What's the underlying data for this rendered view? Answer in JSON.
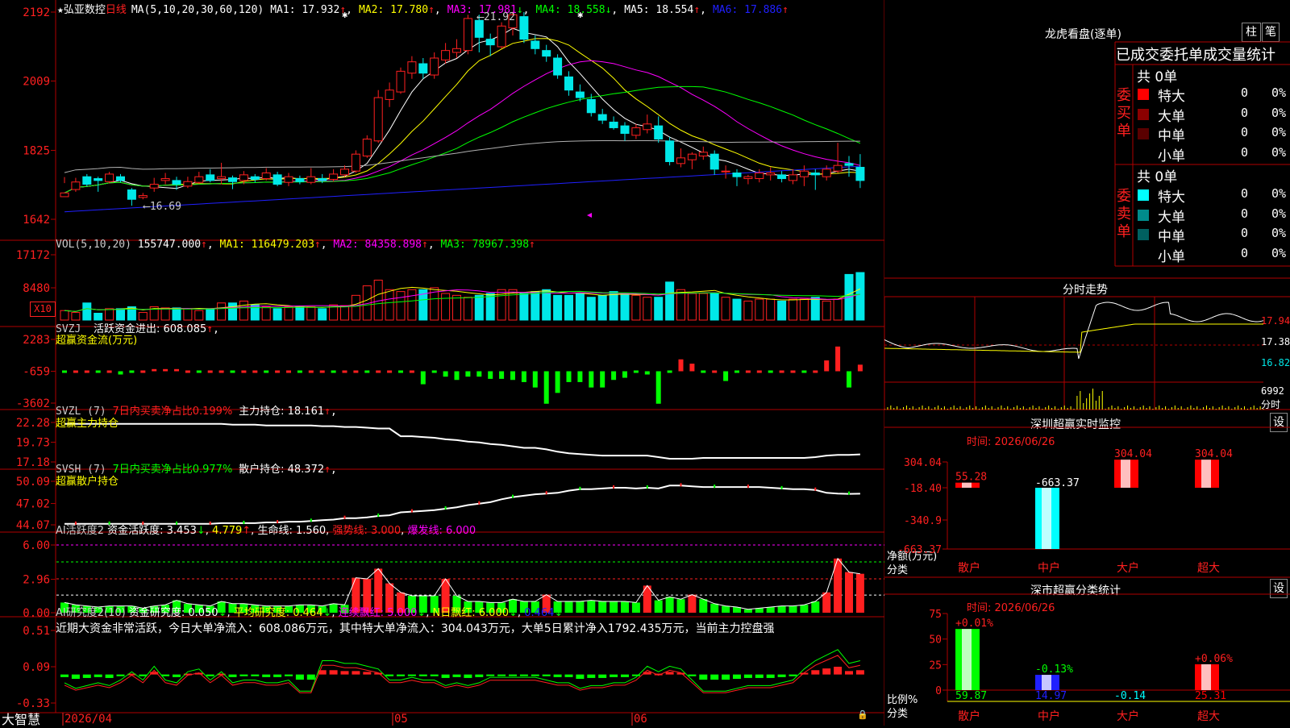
{
  "app": {
    "brand": "大智慧"
  },
  "colors": {
    "up": "#ff2020",
    "down": "#00e8e8",
    "green": "#00ff00",
    "grid": "#b00000",
    "white": "#ffffff",
    "yellow": "#ffff00",
    "magenta": "#ff00ff",
    "blue": "#2020ff"
  },
  "icons": {
    "star": "star-icon",
    "up": "arrow-up-icon",
    "down": "arrow-down-icon",
    "lock": "lock-icon"
  },
  "main": {
    "stock": "弘亚数控",
    "period": "日线",
    "ma_label": "MA(5,10,20,30,60,120)",
    "ma": [
      {
        "label": "MA1: 17.932",
        "dir": "up",
        "color": "#ffffff"
      },
      {
        "label": "MA2: 17.780",
        "dir": "up",
        "color": "#ffff00"
      },
      {
        "label": "MA3: 17.981",
        "dir": "down",
        "color": "#ff00ff"
      },
      {
        "label": "MA4: 18.558",
        "dir": "down",
        "color": "#00ff00"
      },
      {
        "label": "MA5: 18.554",
        "dir": "up",
        "color": "#ffffff"
      },
      {
        "label": "MA6: 17.886",
        "dir": "up",
        "color": "#2020ff"
      }
    ],
    "yticks": [
      "2192",
      "2009",
      "1825",
      "1642"
    ],
    "high_label": "21.92",
    "low_label": "16.69",
    "x_labels": [
      "2026/04",
      "05",
      "06"
    ]
  },
  "vol": {
    "label": "VOL(5,10,20)",
    "value": "155747.000",
    "ma1": "MA1: 116479.203",
    "ma2": "MA2: 84358.898",
    "ma3": "MA3: 78967.398",
    "yticks": [
      "17172",
      "8480"
    ],
    "unit": "X10"
  },
  "svzj": {
    "title": "SVZJ",
    "label": "活跃资金进出: 608.085",
    "sub": "超赢资金流(万元)",
    "yticks": [
      "2283",
      "-659",
      "-3602"
    ]
  },
  "svzl": {
    "title": "SVZL (7)",
    "ratio": "7日内买卖净占比0.199%",
    "hold": "主力持仓: 18.161",
    "sub": "超赢主力持仓",
    "yticks": [
      "22.28",
      "19.73",
      "17.18"
    ]
  },
  "svsh": {
    "title": "SVSH (7)",
    "ratio": "7日内买卖净占比0.977%",
    "hold": "散户持仓: 48.372",
    "sub": "超赢散户持仓",
    "yticks": [
      "50.09",
      "47.02",
      "44.07"
    ]
  },
  "ai1": {
    "title": "AI活跃度2",
    "active": "资金活跃度: 3.453",
    "v2": "4.779",
    "life": "生命线: 1.560",
    "strong": "强势线: 3.000",
    "burst": "爆发线: 6.000",
    "yticks": [
      "6.00",
      "2.96",
      "0.00"
    ]
  },
  "ai2": {
    "title": "AI研究度2(10)",
    "research": "资金研究度: 0.050",
    "avg": "平均研究度: 0.464",
    "cont": "连续飘红: 5.000",
    "nday": "N日飘红: 6.000",
    "v5": "0.464",
    "comment": "近期大资金非常活跃，今日大单净流入：608.086万元，其中特大单净流入：304.043万元，大单5日累计净入1792.435万元，当前主力控盘强",
    "yticks": [
      "0.51",
      "0.09",
      "-0.33"
    ]
  },
  "dragon": {
    "title": "龙虎看盘(逐单)",
    "btn1": "柱",
    "btn2": "笔",
    "header": "已成交委托单成交量统计",
    "buy_label": "委买单",
    "sell_label": "委卖单",
    "buy_total": "共 0单",
    "sell_total": "共 0单",
    "buy_rows": [
      {
        "name": "特大",
        "count": "0",
        "pct": "0%",
        "color": "#ff0000"
      },
      {
        "name": "大单",
        "count": "0",
        "pct": "0%",
        "color": "#8b0000"
      },
      {
        "name": "中单",
        "count": "0",
        "pct": "0%",
        "color": "#5a0000"
      },
      {
        "name": "小单",
        "count": "0",
        "pct": "0%",
        "color": "#000000"
      }
    ],
    "sell_rows": [
      {
        "name": "特大",
        "count": "0",
        "pct": "0%",
        "color": "#00ffff"
      },
      {
        "name": "大单",
        "count": "0",
        "pct": "0%",
        "color": "#008b8b"
      },
      {
        "name": "中单",
        "count": "0",
        "pct": "0%",
        "color": "#006060"
      },
      {
        "name": "小单",
        "count": "0",
        "pct": "0%",
        "color": "#000000"
      }
    ]
  },
  "intraday": {
    "title": "分时走势",
    "prices": [
      "17.94",
      "17.38",
      "16.82"
    ],
    "vol": "6992",
    "vol_unit": "分时"
  },
  "monitor": {
    "title": "深圳超赢实时监控",
    "btn": "设",
    "time": "时间: 2026/06/26",
    "yticks": [
      "304.04",
      "-18.40",
      "-340.9",
      "-663.37"
    ],
    "bars": [
      {
        "label": "散户",
        "value": 55.28,
        "text": "55.28",
        "color": "#ff0000"
      },
      {
        "label": "中户",
        "value": -663.37,
        "text": "-663.37",
        "color": "#00ffff"
      },
      {
        "label": "大户",
        "value": 304.04,
        "text": "304.04",
        "color": "#ff0000"
      },
      {
        "label": "超大",
        "value": 304.04,
        "text": "304.04",
        "color": "#ff0000"
      }
    ],
    "axis_label": "净额(万元)",
    "axis_sub": "分类"
  },
  "stats": {
    "title": "深市超赢分类统计",
    "btn": "设",
    "time": "时间: 2026/06/26",
    "yticks": [
      "75",
      "50",
      "25",
      "0"
    ],
    "bars": [
      {
        "label": "散户",
        "value": 59.87,
        "pct": "+0.01%",
        "bottom": "59.87",
        "color": "#00ff00"
      },
      {
        "label": "中户",
        "value": 14.97,
        "pct": "-0.13%",
        "bottom": "14.97",
        "color": "#2020ff"
      },
      {
        "label": "大户",
        "value": -0.14,
        "pct": "",
        "bottom": "-0.14",
        "color": "#00ffff"
      },
      {
        "label": "超大",
        "value": 25.31,
        "pct": "+0.06%",
        "bottom": "25.31",
        "color": "#ff0000"
      }
    ],
    "axis_label": "比例%",
    "axis_sub": "分类"
  },
  "chart_data": [
    {
      "type": "candlestick",
      "title": "弘亚数控 日线",
      "ylim": [
        16.42,
        21.92
      ],
      "yticks": [
        21.92,
        20.09,
        18.25,
        16.42
      ],
      "candles": [
        [
          17.02,
          17.12,
          17.54,
          17.38
        ],
        [
          17.21,
          17.41,
          17.52,
          17.15
        ],
        [
          17.55,
          17.35,
          17.62,
          17.3
        ],
        [
          17.5,
          17.45,
          17.55,
          17.15
        ],
        [
          17.42,
          17.62,
          17.68,
          17.38
        ],
        [
          17.55,
          17.45,
          17.62,
          17.4
        ],
        [
          17.2,
          16.95,
          17.25,
          16.78
        ],
        [
          17.0,
          17.05,
          17.12,
          16.95
        ],
        [
          17.25,
          17.35,
          17.52,
          17.15
        ],
        [
          17.45,
          17.5,
          17.65,
          17.35
        ],
        [
          17.45,
          17.35,
          17.55,
          17.2
        ],
        [
          17.3,
          17.42,
          17.55,
          17.25
        ],
        [
          17.4,
          17.55,
          17.68,
          17.35
        ],
        [
          17.6,
          17.45,
          17.75,
          17.4
        ],
        [
          17.5,
          17.55,
          17.92,
          17.35
        ],
        [
          17.52,
          17.42,
          17.58,
          17.22
        ],
        [
          17.45,
          17.6,
          17.7,
          17.35
        ],
        [
          17.55,
          17.48,
          17.62,
          17.4
        ],
        [
          17.5,
          17.65,
          17.78,
          17.45
        ],
        [
          17.6,
          17.35,
          17.68,
          17.3
        ],
        [
          17.4,
          17.55,
          17.65,
          17.3
        ],
        [
          17.5,
          17.42,
          17.58,
          17.35
        ],
        [
          17.4,
          17.55,
          17.78,
          17.35
        ],
        [
          17.5,
          17.45,
          17.62,
          17.38
        ],
        [
          17.48,
          17.62,
          17.75,
          17.42
        ],
        [
          17.6,
          17.75,
          17.85,
          17.55
        ],
        [
          17.7,
          18.15,
          18.25,
          17.65
        ],
        [
          18.1,
          18.55,
          18.65,
          18.05
        ],
        [
          18.5,
          19.65,
          19.85,
          18.45
        ],
        [
          19.6,
          19.85,
          20.05,
          19.4
        ],
        [
          19.8,
          20.35,
          20.45,
          19.75
        ],
        [
          20.3,
          20.6,
          20.75,
          20.15
        ],
        [
          20.55,
          20.3,
          20.7,
          20.15
        ],
        [
          20.25,
          20.7,
          20.85,
          20.15
        ],
        [
          20.65,
          20.9,
          21.1,
          20.55
        ],
        [
          20.85,
          20.95,
          21.2,
          20.7
        ],
        [
          20.9,
          21.75,
          21.85,
          20.8
        ],
        [
          21.7,
          21.25,
          21.85,
          20.85
        ],
        [
          21.2,
          21.05,
          21.35,
          20.75
        ],
        [
          21.0,
          21.55,
          21.65,
          20.95
        ],
        [
          21.5,
          21.85,
          21.92,
          21.3
        ],
        [
          21.8,
          21.2,
          21.92,
          21.1
        ],
        [
          21.15,
          20.95,
          21.3,
          20.8
        ],
        [
          20.9,
          20.75,
          21.05,
          20.6
        ],
        [
          20.7,
          20.25,
          20.8,
          20.15
        ],
        [
          20.2,
          19.85,
          20.35,
          19.7
        ],
        [
          19.8,
          19.65,
          20.0,
          19.55
        ],
        [
          19.6,
          19.25,
          19.75,
          19.15
        ],
        [
          19.2,
          19.05,
          19.35,
          18.95
        ],
        [
          19.0,
          18.85,
          19.15,
          18.8
        ],
        [
          18.9,
          18.7,
          19.0,
          18.5
        ],
        [
          18.65,
          18.85,
          18.95,
          18.55
        ],
        [
          18.8,
          18.95,
          19.2,
          18.7
        ],
        [
          18.9,
          18.55,
          19.15,
          18.45
        ],
        [
          18.5,
          17.95,
          18.6,
          17.85
        ],
        [
          17.9,
          18.05,
          18.3,
          17.8
        ],
        [
          18.0,
          18.15,
          18.2,
          17.75
        ],
        [
          18.1,
          18.2,
          18.35,
          18.0
        ],
        [
          18.15,
          17.75,
          18.25,
          17.6
        ],
        [
          17.7,
          17.7,
          17.85,
          17.5
        ],
        [
          17.65,
          17.55,
          17.75,
          17.3
        ],
        [
          17.5,
          17.55,
          17.6,
          17.35
        ],
        [
          17.5,
          17.65,
          17.75,
          17.4
        ],
        [
          17.6,
          17.65,
          17.8,
          17.45
        ],
        [
          17.6,
          17.5,
          17.7,
          17.4
        ],
        [
          17.45,
          17.6,
          17.75,
          17.35
        ],
        [
          17.55,
          17.7,
          17.85,
          17.3
        ],
        [
          17.65,
          17.6,
          17.75,
          17.2
        ],
        [
          17.55,
          17.75,
          17.85,
          17.45
        ],
        [
          17.7,
          17.85,
          18.45,
          17.65
        ],
        [
          17.9,
          17.85,
          18.1,
          17.55
        ],
        [
          17.8,
          17.45,
          18.15,
          17.25
        ]
      ],
      "series": [
        {
          "name": "MA1"
        },
        {
          "name": "MA2"
        },
        {
          "name": "MA3"
        },
        {
          "name": "MA4"
        },
        {
          "name": "MA5"
        },
        {
          "name": "MA6"
        }
      ]
    },
    {
      "type": "bar",
      "title": "VOL(5,10,20)",
      "ylim": [
        0,
        17172
      ],
      "values": [
        2500,
        2000,
        4500,
        1800,
        3000,
        3000,
        3500,
        2000,
        3500,
        3200,
        3200,
        3000,
        2500,
        3000,
        4500,
        4500,
        5000,
        4000,
        3500,
        3000,
        3500,
        3500,
        3500,
        3000,
        4000,
        3800,
        6500,
        9000,
        10500,
        8000,
        7500,
        8000,
        8000,
        8500,
        7000,
        6500,
        6000,
        6500,
        7000,
        8000,
        8000,
        7000,
        7500,
        8000,
        6500,
        6500,
        7000,
        6000,
        6500,
        7500,
        7000,
        6500,
        6000,
        6000,
        10000,
        8000,
        7000,
        7000,
        7000,
        6000,
        5500,
        5000,
        5500,
        5500,
        5000,
        5500,
        5500,
        6000,
        5000,
        5500,
        12000,
        12500
      ]
    },
    {
      "type": "bar",
      "title": "SVZJ",
      "ylim": [
        -3602,
        2283
      ],
      "values": [
        0,
        0,
        0,
        0,
        0,
        -300,
        0,
        0,
        200,
        200,
        200,
        0,
        0,
        0,
        0,
        0,
        0,
        0,
        0,
        0,
        0,
        0,
        0,
        0,
        0,
        0,
        0,
        0,
        0,
        0,
        0,
        0,
        -1200,
        0,
        -500,
        -800,
        -500,
        -500,
        -700,
        -700,
        -800,
        -1000,
        -1500,
        -3000,
        -2000,
        -1000,
        -1000,
        -1500,
        -1500,
        -800,
        -600,
        0,
        -300,
        -3000,
        0,
        1100,
        700,
        0,
        0,
        -900,
        0,
        0,
        0,
        0,
        0,
        0,
        0,
        0,
        1000,
        2283,
        -1500,
        608
      ]
    },
    {
      "type": "line",
      "title": "SVZL (7)",
      "ylim": [
        17.18,
        22.28
      ],
      "values": [
        22.1,
        22.1,
        22.1,
        22.1,
        22.1,
        22.1,
        22.1,
        22.1,
        22.1,
        22.1,
        22.1,
        22.1,
        22.1,
        22.1,
        22.1,
        22.0,
        22.0,
        22.0,
        21.9,
        21.9,
        21.9,
        21.9,
        21.9,
        21.8,
        21.8,
        21.7,
        21.7,
        21.6,
        21.5,
        21.5,
        20.5,
        20.5,
        20.4,
        20.3,
        20.1,
        20.0,
        19.8,
        19.7,
        19.5,
        19.4,
        19.2,
        19.0,
        19.0,
        18.8,
        18.5,
        18.3,
        18.2,
        18.1,
        18.0,
        18.0,
        18.0,
        18.0,
        18.0,
        17.8,
        17.6,
        17.6,
        17.6,
        17.7,
        17.7,
        17.7,
        17.7,
        17.7,
        17.7,
        17.7,
        17.7,
        17.7,
        17.7,
        17.8,
        18.0,
        18.1,
        18.1,
        18.16
      ]
    },
    {
      "type": "line",
      "title": "SVSH (7)",
      "ylim": [
        44.07,
        50.09
      ],
      "values": [
        44.2,
        44.2,
        44.2,
        44.2,
        44.2,
        44.2,
        44.2,
        44.2,
        44.2,
        44.2,
        44.2,
        44.2,
        44.2,
        44.2,
        44.3,
        44.3,
        44.3,
        44.3,
        44.4,
        44.4,
        44.5,
        44.5,
        44.6,
        44.7,
        44.8,
        45.0,
        45.0,
        45.1,
        45.3,
        45.4,
        45.8,
        45.9,
        46.0,
        46.1,
        46.3,
        46.5,
        46.8,
        47.0,
        47.2,
        47.6,
        47.9,
        48.1,
        48.3,
        48.4,
        48.5,
        48.8,
        49.0,
        49.0,
        49.1,
        49.2,
        49.2,
        49.1,
        49.2,
        49.1,
        49.5,
        49.5,
        49.4,
        49.3,
        49.3,
        49.3,
        49.3,
        49.3,
        49.3,
        49.2,
        49.1,
        49.0,
        49.0,
        48.9,
        48.5,
        48.4,
        48.35,
        48.37
      ]
    },
    {
      "type": "bar",
      "title": "AI活跃度2",
      "ylim": [
        0,
        6.0
      ],
      "values": [
        0.9,
        0.7,
        0.6,
        0.5,
        0.6,
        0.6,
        0.6,
        0.4,
        0.6,
        0.7,
        1.1,
        0.8,
        0.7,
        0.6,
        1.0,
        0.8,
        0.8,
        0.7,
        0.6,
        0.6,
        0.6,
        0.7,
        0.7,
        0.6,
        0.8,
        0.7,
        3.1,
        3.0,
        3.9,
        2.6,
        1.8,
        1.5,
        1.5,
        1.5,
        3.0,
        1.5,
        1.0,
        1.0,
        0.9,
        0.9,
        1.2,
        1.0,
        1.0,
        1.6,
        1.0,
        1.0,
        1.0,
        1.1,
        1.0,
        1.0,
        1.0,
        0.9,
        2.4,
        1.1,
        1.4,
        1.2,
        1.6,
        1.2,
        0.8,
        0.6,
        0.5,
        0.3,
        0.4,
        0.5,
        0.6,
        0.6,
        0.7,
        1.0,
        1.8,
        4.8,
        3.6,
        3.45
      ]
    },
    {
      "type": "bar",
      "title": "AI研究度2(10)",
      "ylim": [
        -0.33,
        0.51
      ],
      "values": [
        -0.03,
        -0.05,
        -0.04,
        -0.03,
        -0.04,
        -0.02,
        0.01,
        -0.02,
        0.03,
        -0.02,
        -0.03,
        0.01,
        0.02,
        -0.02,
        0.01,
        -0.03,
        -0.02,
        -0.02,
        -0.03,
        -0.03,
        -0.02,
        -0.06,
        -0.06,
        0.05,
        0.05,
        0.04,
        0.04,
        0.03,
        0.02,
        -0.02,
        -0.02,
        -0.01,
        -0.02,
        -0.02,
        -0.04,
        -0.03,
        -0.04,
        -0.03,
        -0.01,
        -0.01,
        -0.01,
        -0.01,
        -0.01,
        -0.02,
        -0.03,
        -0.03,
        -0.05,
        -0.04,
        -0.04,
        -0.03,
        -0.03,
        -0.01,
        0.03,
        0.01,
        0.03,
        0.02,
        -0.02,
        -0.06,
        -0.06,
        -0.06,
        -0.05,
        -0.04,
        -0.04,
        -0.04,
        -0.03,
        -0.02,
        0.02,
        0.05,
        0.07,
        0.09,
        0.04,
        0.05
      ]
    }
  ]
}
